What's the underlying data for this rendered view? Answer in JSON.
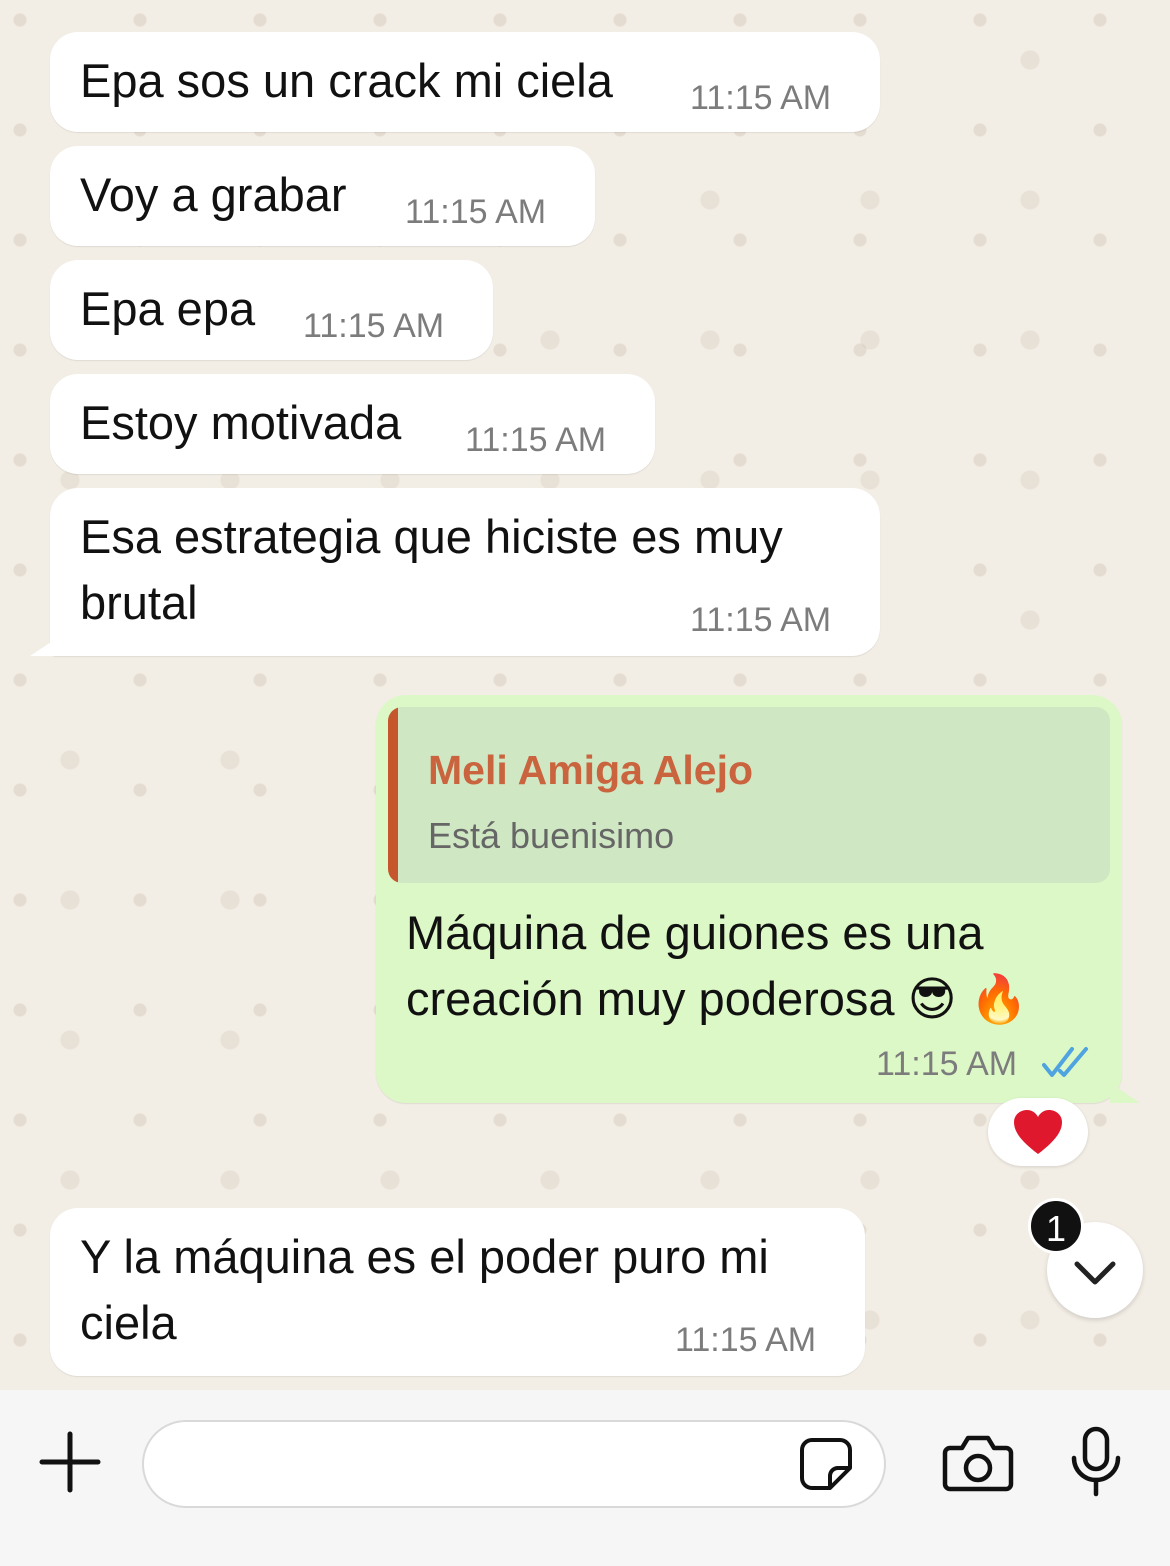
{
  "incoming": [
    {
      "text": "Epa sos un crack mi ciela",
      "time": "11:15 AM"
    },
    {
      "text": "Voy a grabar",
      "time": "11:15 AM"
    },
    {
      "text": "Epa epa",
      "time": "11:15 AM"
    },
    {
      "text": "Estoy motivada",
      "time": "11:15 AM"
    },
    {
      "text": "Esa estrategia que hiciste es muy\nbrutal",
      "time": "11:15 AM"
    }
  ],
  "outgoing": {
    "quote_author": "Meli Amiga Alejo",
    "quote_text": "Está buenisimo",
    "text": "Máquina de guiones es una\ncreación muy poderosa 😎 🔥",
    "time": "11:15 AM",
    "status_icon": "double-check-read-icon",
    "reaction": "❤️"
  },
  "last_incoming": {
    "text": "Y la máquina es el poder puro mi\nciela",
    "time": "11:15 AM"
  },
  "scroll": {
    "unread_count": "1",
    "icon": "chevron-down-icon"
  },
  "composer": {
    "input_value": "",
    "icons": [
      "plus-icon",
      "sticker-icon",
      "camera-icon",
      "microphone-icon"
    ]
  },
  "colors": {
    "incoming_bubble": "#ffffff",
    "outgoing_bubble": "#dcf8c6",
    "quote_accent": "#c6562c",
    "read_ticks": "#4fa3e0"
  }
}
